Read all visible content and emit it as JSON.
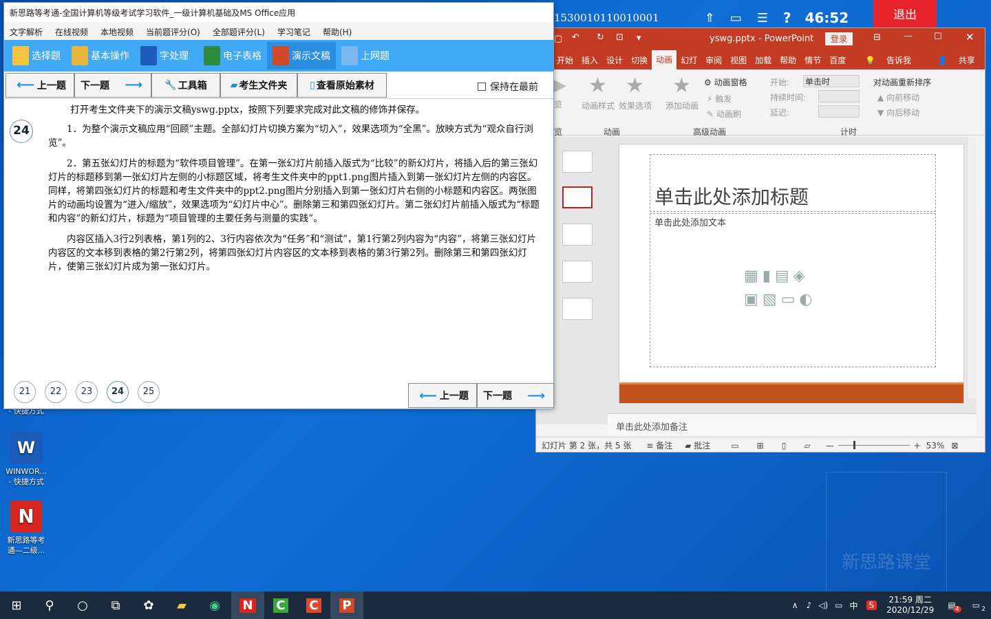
{
  "desktop": {
    "icon_shortcut_partial": "- 快捷方式",
    "icon_winword_name": "WINWOR...",
    "icon_winword_sub": "- 快捷方式",
    "icon_xsl_name": "新思路等考",
    "icon_xsl_sub": "通—二级...",
    "watermark_text": "新思路课堂"
  },
  "exam_window": {
    "title": "新思路等考通-全国计算机等级考试学习软件_一级计算机基础及MS Office应用",
    "menu": [
      "文字解析",
      "在线视频",
      "本地视频",
      "当前题评分(O)",
      "全部题评分(L)",
      "学习笔记",
      "帮助(H)"
    ],
    "modes": [
      "选择题",
      "基本操作",
      "字处理",
      "电子表格",
      "演示文稿",
      "上网题"
    ],
    "active_mode_index": 4,
    "toolbar": {
      "prev": "上一题",
      "next": "下一题",
      "toolbox": "工具箱",
      "exam_folder": "考生文件夹",
      "view_material": "查看原始素材",
      "keep_on_top": "保持在最前"
    },
    "question_number": "24",
    "question_intro": "打开考生文件夹下的演示文稿yswg.pptx，按照下列要求完成对此文稿的修饰并保存。",
    "paragraphs": [
      "1．为整个演示文稿应用“回顾”主题。全部幻灯片切换方案为“切入”，效果选项为“全黑”。放映方式为“观众自行浏览”。",
      "2．第五张幻灯片的标题为“软件项目管理”。在第一张幻灯片前插入版式为“比较”的新幻灯片，将插入后的第三张幻灯片的标题移到第一张幻灯片左侧的小标题区域，将考生文件夹中的ppt1.png图片插入到第一张幻灯片左侧的内容区。同样，将第四张幻灯片的标题和考生文件夹中的ppt2.png图片分别插入到第一张幻灯片右侧的小标题和内容区。两张图片的动画均设置为“进入/缩放”，效果选项为“幻灯片中心”。删除第三和第四张幻灯片。第二张幻灯片前插入版式为“标题和内容”的新幻灯片，标题为“项目管理的主要任务与测量的实践”。",
      "内容区插入3行2列表格，第1列的2、3行内容依次为“任务”和“测试”，第1行第2列内容为“内容”，将第三张幻灯片内容区的文本移到表格的第2行第2列，将第四张幻灯片内容区的文本移到表格的第3行第2列。删除第三和第四张幻灯片，使第三张幻灯片成为第一张幻灯片。"
    ],
    "pager": [
      "21",
      "22",
      "23",
      "24",
      "25"
    ],
    "current_page": "24",
    "bottom_prev": "上一题",
    "bottom_next": "下一题"
  },
  "top_status": {
    "exam_id": "1530010110010001",
    "timer": "46:52",
    "exit": "退出"
  },
  "ppt": {
    "filename": "yswg.pptx",
    "app": "PowerPoint",
    "login": "登录",
    "tabs": [
      "件",
      "开始",
      "插入",
      "设计",
      "切换",
      "动画",
      "幻灯",
      "审阅",
      "视图",
      "加载",
      "帮助",
      "情节",
      "百度"
    ],
    "active_tab_index": 5,
    "tell_me": "告诉我",
    "share": "共享",
    "ribbon": {
      "preview": "览",
      "anim_style": "动画样式",
      "effect_options": "效果选项",
      "add_anim": "添加动画",
      "anim_pane": "动画窗格",
      "trigger": "触发",
      "anim_painter": "动画刷",
      "start_label": "开始:",
      "start_value": "单击时",
      "duration_label": "持续时间:",
      "delay_label": "延迟:",
      "reorder": "对动画重新排序",
      "move_earlier": "向前移动",
      "move_later": "向后移动",
      "group_preview": "览",
      "group_anim": "动画",
      "group_adv": "高级动画",
      "group_timing": "计时"
    },
    "slide_title_placeholder": "单击此处添加标题",
    "slide_text_placeholder": "单击此处添加文本",
    "notes_placeholder": "单击此处添加备注",
    "status": {
      "slide_info": "幻灯片 第 2 张，共 5 张",
      "notes": "备注",
      "comments": "批注",
      "zoom": "53%"
    },
    "colors": {
      "accent": "#c23b22",
      "slide_band": "#c0521c"
    }
  },
  "taskbar": {
    "time": "21:59 周二",
    "date": "2020/12/29",
    "ime": "中",
    "notify_count": "4",
    "chat_count": "2"
  }
}
